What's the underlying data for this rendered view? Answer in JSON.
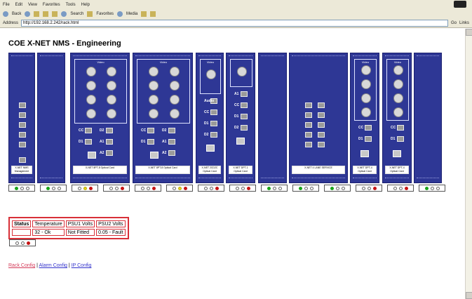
{
  "browser": {
    "menu": [
      "File",
      "Edit",
      "View",
      "Favorites",
      "Tools",
      "Help"
    ],
    "toolbar": {
      "back": "Back",
      "search": "Search",
      "favorites": "Favorites",
      "media": "Media"
    },
    "address_label": "Address",
    "address_value": "http://192.168.2.242/rack.html",
    "go": "Go",
    "links": "Links"
  },
  "page": {
    "title": "COE X-NET NMS - Engineering"
  },
  "rack": {
    "video_label": "Video",
    "optical_label": "Optical",
    "port_labels": {
      "cc": "CC",
      "d1": "D1",
      "d2": "D2",
      "a1": "A1",
      "a2": "A2",
      "audio": "Audio"
    },
    "card_names": {
      "c1": "X-NET NMS Management",
      "c3": "X-NET 8PT-8 Optical Card",
      "c4": "X-NET 8PT-8 Optical Card",
      "c5": "X-NET 2CD2C Optical Card",
      "c6": "X-NET DPT-1 Optical Card",
      "c8": "X-NET 4 LANE SERVICE",
      "c9": "X-NET DPT-4 Optical Card",
      "c10": "X-NET DPT-4 Optical Card"
    },
    "leds": [
      [
        "green",
        "off",
        "off"
      ],
      [
        "green",
        "off",
        "off"
      ],
      [
        "off",
        "yellow",
        "red"
      ],
      [
        "off",
        "off",
        "red"
      ],
      [
        "off",
        "off",
        "red"
      ],
      [
        "off",
        "yellow",
        "red"
      ],
      [
        "off",
        "off",
        "red"
      ],
      [
        "off",
        "off",
        "red"
      ],
      [
        "green",
        "off",
        "off"
      ],
      [
        "green",
        "off",
        "off"
      ],
      [
        "green",
        "off",
        "off"
      ],
      [
        "off",
        "off",
        "red"
      ],
      [
        "off",
        "off",
        "red"
      ],
      [
        "green",
        "off",
        "off"
      ]
    ]
  },
  "status": {
    "headers": [
      "Status",
      "Temperature",
      "PSU1 Volts",
      "PSU2 Volts"
    ],
    "values": [
      "",
      "32 - Ok",
      "Not Fitted",
      "0.05 - Fault"
    ],
    "leds": [
      "off",
      "off",
      "red"
    ]
  },
  "nav": {
    "rack_config": "Rack Config",
    "alarm_config": "Alarm Config",
    "ip_config": "IP Config",
    "sep": "|"
  },
  "colors": {
    "card": "#2e3795",
    "alert_border": "#d83038",
    "link": "#3333cc"
  }
}
